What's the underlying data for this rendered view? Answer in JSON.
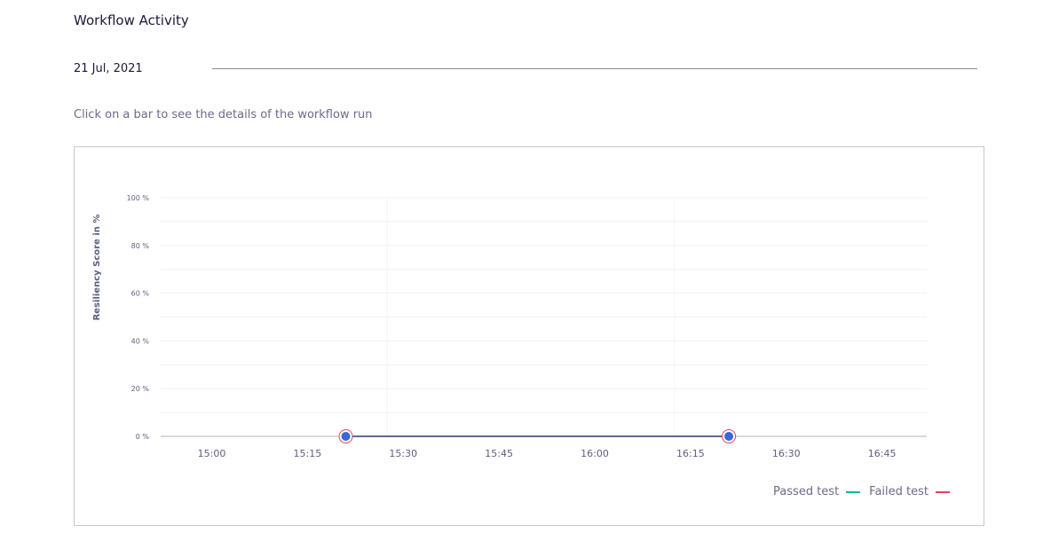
{
  "header": {
    "title": "Workflow Activity",
    "date": "21 Jul, 2021",
    "hint": "Click on a bar to see the details of the workflow run"
  },
  "legend": {
    "passed_label": "Passed test",
    "failed_label": "Failed test",
    "passed_color": "#10b39e",
    "failed_color": "#e5405c"
  },
  "chart_data": {
    "type": "line",
    "ylabel": "Resiliency Score in %",
    "ylim": [
      0,
      100
    ],
    "y_ticks": [
      "0 %",
      "20 %",
      "40 %",
      "60 %",
      "80 %",
      "100 %"
    ],
    "x_ticks": [
      "15:00",
      "15:15",
      "15:30",
      "15:45",
      "16:00",
      "16:15",
      "16:30",
      "16:45"
    ],
    "xlim": [
      "14:52",
      "16:52"
    ],
    "series": [
      {
        "points": [
          {
            "x": "15:21",
            "y": 0,
            "status": "failed"
          },
          {
            "x": "16:21",
            "y": 0,
            "status": "failed"
          }
        ]
      }
    ],
    "line_color": "#5b6a9a",
    "point_color": "#3b66d6",
    "grid": true
  }
}
